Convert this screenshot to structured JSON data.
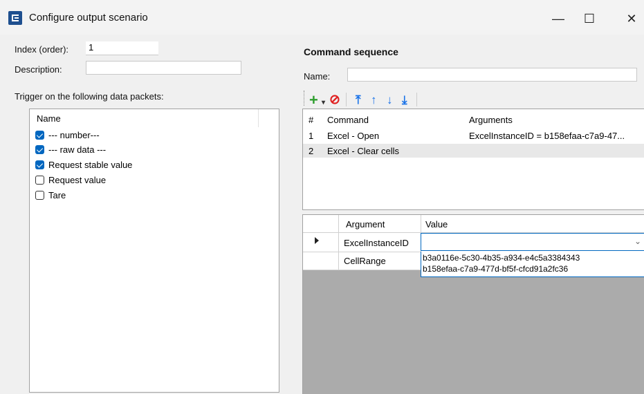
{
  "window": {
    "title": "Configure output scenario",
    "minimize": "—",
    "maximize": "☐",
    "close": "✕"
  },
  "left": {
    "index_label": "Index (order):",
    "index_value": "1",
    "description_label": "Description:",
    "description_value": "",
    "trigger_label": "Trigger on the following data packets:",
    "list_header": "Name",
    "items": [
      {
        "label": "--- number---",
        "checked": true
      },
      {
        "label": "--- raw data ---",
        "checked": true
      },
      {
        "label": "Request stable value",
        "checked": true
      },
      {
        "label": "Request value",
        "checked": false
      },
      {
        "label": "Tare",
        "checked": false
      }
    ]
  },
  "right": {
    "section_title": "Command sequence",
    "name_label": "Name:",
    "name_value": "",
    "toolbar": {
      "add": "+",
      "dropdown": "▾",
      "remove": "⊘",
      "move_top": "⤒",
      "move_up": "↑",
      "move_down": "↓",
      "move_bottom": "⤓"
    },
    "commands_columns": {
      "num": "#",
      "command": "Command",
      "arguments": "Arguments"
    },
    "commands": [
      {
        "num": "1",
        "command": "Excel - Open",
        "arguments": "ExcelInstanceID = b158efaa-c7a9-47..."
      },
      {
        "num": "2",
        "command": "Excel - Clear cells",
        "arguments": ""
      }
    ],
    "args_columns": {
      "argument": "Argument",
      "value": "Value"
    },
    "args": [
      {
        "argument": "ExcelInstanceID",
        "value": ""
      },
      {
        "argument": "CellRange",
        "value": ""
      }
    ],
    "dropdown_options": [
      "b3a0116e-5c30-4b35-a934-e4c5a3384343",
      "b158efaa-c7a9-477d-bf5f-cfcd91a2fc36"
    ]
  },
  "colors": {
    "accent": "#0067c0",
    "add_green": "#2e9e2e",
    "remove_red": "#e02020",
    "arrow_blue": "#1a73e8"
  }
}
